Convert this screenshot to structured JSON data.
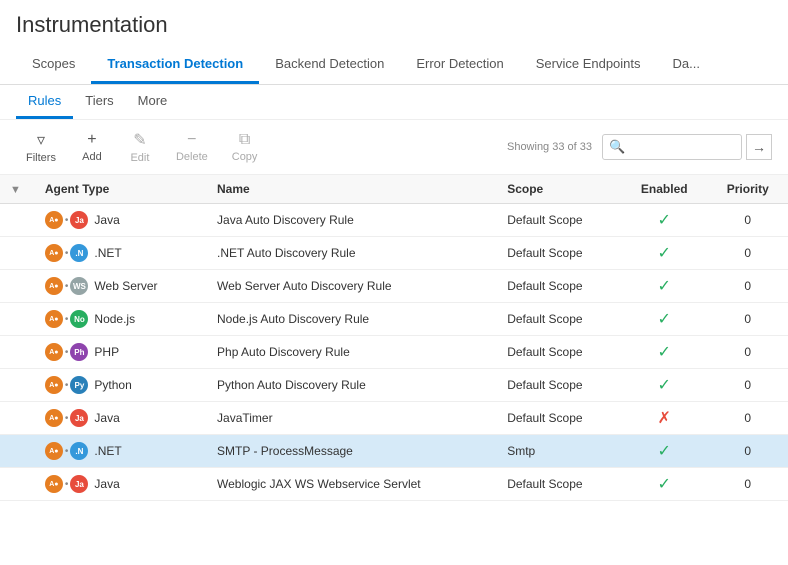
{
  "page": {
    "title": "Instrumentation"
  },
  "mainTabs": [
    {
      "id": "scopes",
      "label": "Scopes",
      "active": false
    },
    {
      "id": "transaction-detection",
      "label": "Transaction Detection",
      "active": true
    },
    {
      "id": "backend-detection",
      "label": "Backend Detection",
      "active": false
    },
    {
      "id": "error-detection",
      "label": "Error Detection",
      "active": false
    },
    {
      "id": "service-endpoints",
      "label": "Service Endpoints",
      "active": false
    },
    {
      "id": "da",
      "label": "Da...",
      "active": false
    }
  ],
  "subTabs": [
    {
      "id": "rules",
      "label": "Rules",
      "active": true
    },
    {
      "id": "tiers",
      "label": "Tiers",
      "active": false
    },
    {
      "id": "more",
      "label": "More",
      "active": false
    }
  ],
  "toolbar": {
    "filter_label": "Filters",
    "add_label": "Add",
    "edit_label": "Edit",
    "delete_label": "Delete",
    "copy_label": "Copy",
    "search_placeholder": "",
    "showing_text": "Showing 33 of 33"
  },
  "columns": [
    {
      "id": "agent-type",
      "label": "Agent Type"
    },
    {
      "id": "name",
      "label": "Name"
    },
    {
      "id": "scope",
      "label": "Scope"
    },
    {
      "id": "enabled",
      "label": "Enabled"
    },
    {
      "id": "priority",
      "label": "Priority"
    }
  ],
  "rows": [
    {
      "agent": "java",
      "agentLabel": "Java",
      "name": "Java Auto Discovery Rule",
      "scope": "Default Scope",
      "enabled": true,
      "priority": "0",
      "highlighted": false
    },
    {
      "agent": "net",
      "agentLabel": ".NET",
      "name": ".NET Auto Discovery Rule",
      "scope": "Default Scope",
      "enabled": true,
      "priority": "0",
      "highlighted": false
    },
    {
      "agent": "ws",
      "agentLabel": "Web Server",
      "name": "Web Server Auto Discovery Rule",
      "scope": "Default Scope",
      "enabled": true,
      "priority": "0",
      "highlighted": false
    },
    {
      "agent": "node",
      "agentLabel": "Node.js",
      "name": "Node.js Auto Discovery Rule",
      "scope": "Default Scope",
      "enabled": true,
      "priority": "0",
      "highlighted": false
    },
    {
      "agent": "php",
      "agentLabel": "PHP",
      "name": "Php Auto Discovery Rule",
      "scope": "Default Scope",
      "enabled": true,
      "priority": "0",
      "highlighted": false
    },
    {
      "agent": "python",
      "agentLabel": "Python",
      "name": "Python Auto Discovery Rule",
      "scope": "Default Scope",
      "enabled": true,
      "priority": "0",
      "highlighted": false
    },
    {
      "agent": "java",
      "agentLabel": "Java",
      "name": "JavaTimer",
      "scope": "Default Scope",
      "enabled": false,
      "priority": "0",
      "highlighted": false
    },
    {
      "agent": "net",
      "agentLabel": ".NET",
      "name": "SMTP - ProcessMessage",
      "scope": "Smtp",
      "enabled": true,
      "priority": "0",
      "highlighted": true
    },
    {
      "agent": "java",
      "agentLabel": "Java",
      "name": "Weblogic JAX WS Webservice Servlet",
      "scope": "Default Scope",
      "enabled": true,
      "priority": "0",
      "highlighted": false
    }
  ]
}
